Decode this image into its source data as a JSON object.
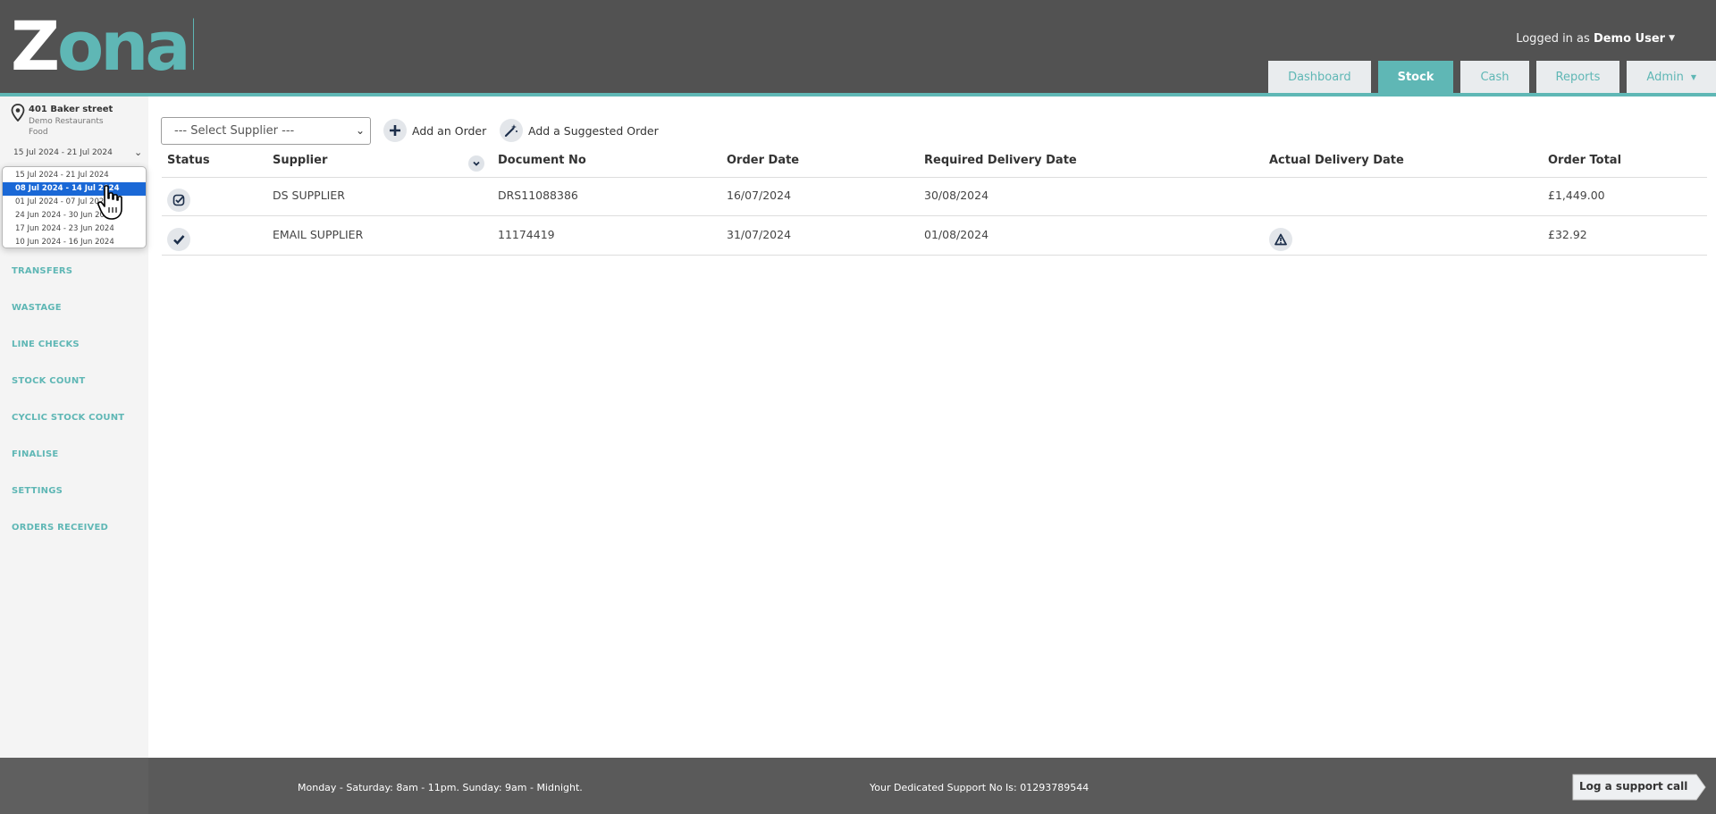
{
  "brand": {
    "logo_text": "Zonal",
    "accent_color": "#5fb7b5",
    "header_color": "#525252"
  },
  "user": {
    "prefix": "Logged in as",
    "name": "Demo User"
  },
  "tabs": [
    {
      "label": "Dashboard",
      "active": false
    },
    {
      "label": "Stock",
      "active": true
    },
    {
      "label": "Cash",
      "active": false
    },
    {
      "label": "Reports",
      "active": false
    },
    {
      "label": "Admin",
      "active": false,
      "has_menu": true
    }
  ],
  "location": {
    "street": "401 Baker street",
    "company": "Demo Restaurants",
    "category": "Food"
  },
  "period": {
    "current": "15 Jul 2024 - 21 Jul 2024",
    "options": [
      {
        "label": "15 Jul 2024 - 21 Jul 2024",
        "selected": false
      },
      {
        "label": "08 Jul 2024 - 14 Jul 2024",
        "selected": true
      },
      {
        "label": "01 Jul 2024 - 07 Jul 2024",
        "selected": false
      },
      {
        "label": "24 Jun 2024 - 30 Jun 2024",
        "selected": false
      },
      {
        "label": "17 Jun 2024 - 23 Jun 2024",
        "selected": false
      },
      {
        "label": "10 Jun 2024 - 16 Jun 2024",
        "selected": false
      }
    ]
  },
  "sidebar": {
    "items": [
      {
        "label": "TRANSFERS"
      },
      {
        "label": "WASTAGE"
      },
      {
        "label": "LINE CHECKS"
      },
      {
        "label": "STOCK COUNT"
      },
      {
        "label": "CYCLIC STOCK COUNT"
      },
      {
        "label": "FINALISE"
      },
      {
        "label": "SETTINGS"
      },
      {
        "label": "ORDERS RECEIVED"
      }
    ]
  },
  "toolbar": {
    "supplier_placeholder": "--- Select Supplier ---",
    "add_order_label": "Add an Order",
    "add_suggested_label": "Add a Suggested Order"
  },
  "table": {
    "columns": [
      "Status",
      "Supplier",
      "Document No",
      "Order Date",
      "Required Delivery Date",
      "Actual Delivery Date",
      "Order Total"
    ],
    "rows": [
      {
        "status_icon": "checkbox-check-icon",
        "supplier": "DS SUPPLIER",
        "document_no": "DRS11088386",
        "order_date": "16/07/2024",
        "required_delivery": "30/08/2024",
        "actual_delivery": "",
        "actual_delivery_icon": "",
        "total": "£1,449.00"
      },
      {
        "status_icon": "check-icon",
        "supplier": "EMAIL SUPPLIER",
        "document_no": "11174419",
        "order_date": "31/07/2024",
        "required_delivery": "01/08/2024",
        "actual_delivery": "",
        "actual_delivery_icon": "warning-icon",
        "total": "£32.92"
      }
    ]
  },
  "footer": {
    "hours": "Monday - Saturday: 8am - 11pm. Sunday: 9am - Midnight.",
    "support_number": "Your Dedicated Support No Is: 01293789544",
    "support_button": "Log a support call"
  }
}
